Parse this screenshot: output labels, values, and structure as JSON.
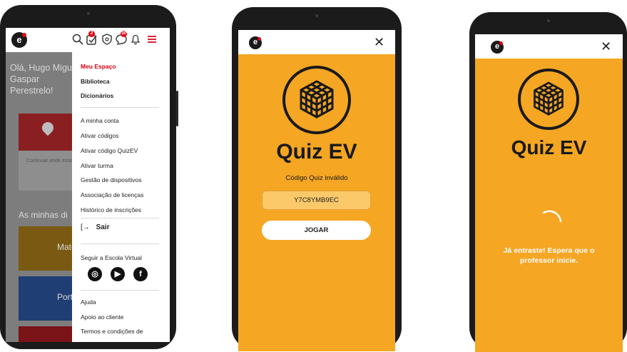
{
  "phone1": {
    "logo": "e",
    "header_badges": [
      "2",
      "30"
    ],
    "background": {
      "greeting": "Olá, Hugo Miguel Gaspar Perestrelo!",
      "card_text": "Continuar onde estavas!",
      "section_heading": "As minhas di",
      "card2_label": "Mate",
      "card3_label": "Port"
    },
    "menu": {
      "primary": [
        "Meu Espaço",
        "Biblioteca",
        "Dicionários"
      ],
      "secondary": [
        "A minha conta",
        "Ativar códigos",
        "Ativar código QuizEV",
        "Ativar turma",
        "Gestão de dispositivos",
        "Associação de licenças",
        "Histórico de inscrições"
      ],
      "logout": "Sair",
      "follow_label": "Seguir a Escola Virtual",
      "footer": [
        "Ajuda",
        "Apoio ao cliente",
        "Termos e condições de"
      ]
    },
    "colors": {
      "accent": "#d40012",
      "overlay": "#7d7d7d"
    }
  },
  "quiz_invalid": {
    "logo": "e",
    "title": "Quiz EV",
    "message": "Código Quiz inválido",
    "code_value": "Y7C8YMB9EC",
    "play_button": "JOGAR"
  },
  "quiz_waiting": {
    "logo": "e",
    "title": "Quiz EV",
    "message": "Já entraste! Espera que o professor inicie."
  },
  "colors": {
    "quiz_bg": "#f5a623",
    "brand_red": "#e30613"
  }
}
